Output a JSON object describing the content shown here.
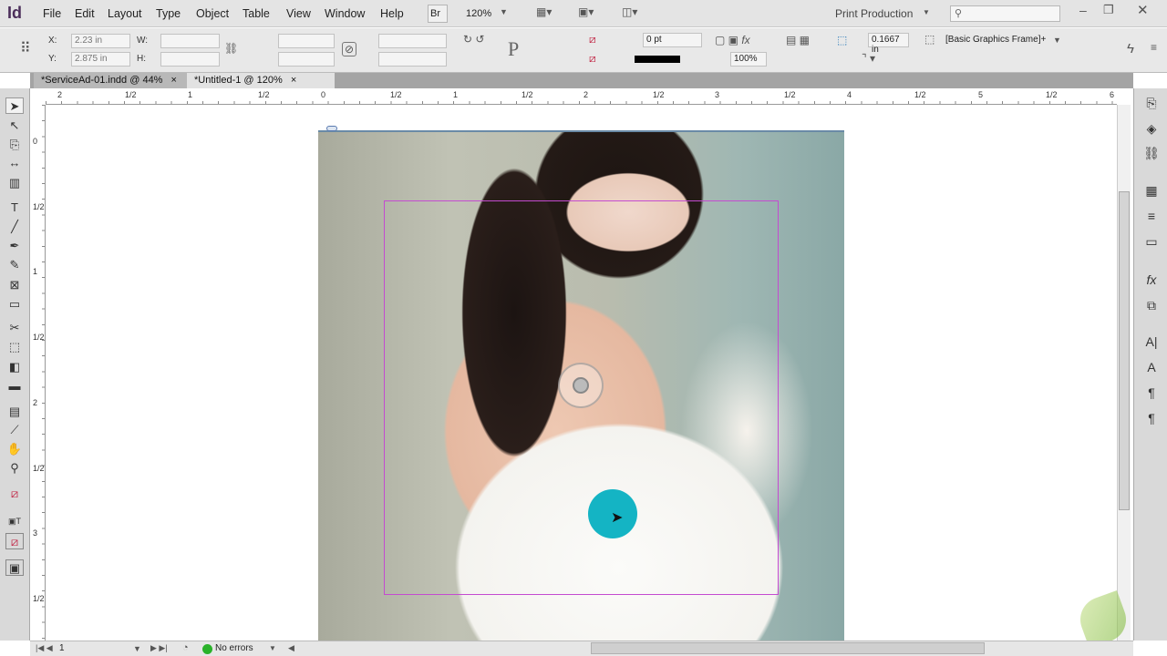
{
  "app": {
    "logo": "Id"
  },
  "menu": [
    "File",
    "Edit",
    "Layout",
    "Type",
    "Object",
    "Table",
    "View",
    "Window",
    "Help"
  ],
  "topbar": {
    "bridge": "Br",
    "zoom": "120%",
    "workspace": "Print Production",
    "search_placeholder": ""
  },
  "control": {
    "x_label": "X:",
    "x_value": "2.23 in",
    "y_label": "Y:",
    "y_value": "2.875 in",
    "w_label": "W:",
    "w_value": "",
    "h_label": "H:",
    "h_value": "",
    "stroke_weight": "0 pt",
    "opacity": "100%",
    "offset": "0.1667 in",
    "object_style": "[Basic Graphics Frame]+"
  },
  "tabs": [
    {
      "label": "*ServiceAd-01.indd @ 44%",
      "active": false
    },
    {
      "label": "*Untitled-1 @ 120%",
      "active": true
    }
  ],
  "hruler": [
    "2",
    "1/2",
    "1",
    "1/2",
    "0",
    "1/2",
    "1",
    "1/2",
    "2",
    "1/2",
    "3",
    "1/2",
    "4",
    "1/2",
    "5",
    "1/2",
    "6"
  ],
  "vruler": [
    "0",
    "1/2",
    "1",
    "1/2",
    "2",
    "1/2",
    "3",
    "1/2"
  ],
  "status": {
    "page": "1",
    "preflight": "No errors"
  },
  "colors": {
    "frame": "#c44bd0",
    "click_indicator": "#14b4c4",
    "preflight_ok": "#2ab22a"
  }
}
